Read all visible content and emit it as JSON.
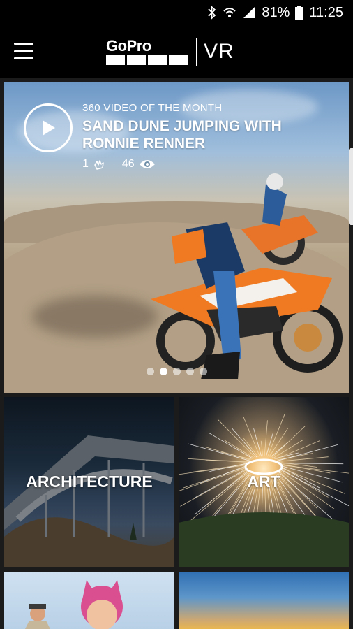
{
  "status_bar": {
    "battery_percent": "81%",
    "time": "11:25",
    "icons": [
      "bluetooth-icon",
      "wifi-icon",
      "signal-icon",
      "battery-icon"
    ]
  },
  "header": {
    "menu_icon": "hamburger-menu-icon",
    "logo_brand": "GoPro",
    "logo_product": "VR"
  },
  "hero": {
    "kicker": "360 VIDEO OF THE MONTH",
    "title": "SAND DUNE JUMPING WITH RONNIE RENNER",
    "likes": "1",
    "views": "46",
    "play_icon": "play-icon",
    "carousel": {
      "count": 5,
      "active_index": 1
    }
  },
  "categories": [
    {
      "label": "ARCHITECTURE"
    },
    {
      "label": "ART"
    },
    {
      "label": ""
    },
    {
      "label": ""
    }
  ],
  "colors": {
    "background": "#1b1b1b",
    "header": "#000000",
    "text": "#ffffff"
  }
}
